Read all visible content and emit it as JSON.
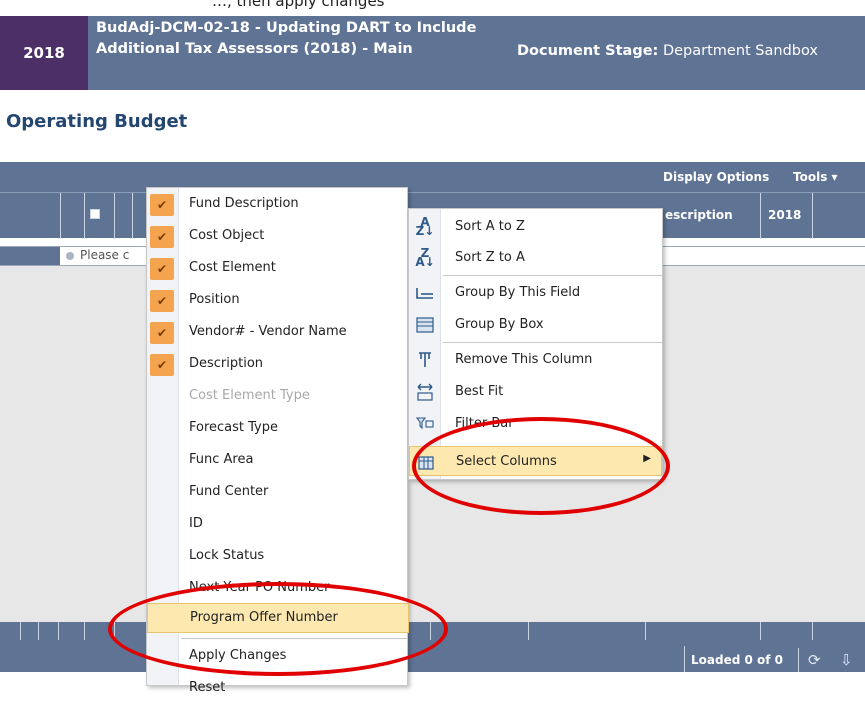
{
  "top_cut_text": "…, then apply changes",
  "header": {
    "year": "2018",
    "title": "BudAdj-DCM-02-18 - Updating DART to Include Additional Tax Assessors (2018) - Main",
    "stage_label": "Document Stage:",
    "stage_value": "Department Sandbox"
  },
  "page": {
    "title": "Operating Budget"
  },
  "grid": {
    "toolbar": {
      "display_options": "Display Options",
      "tools": "Tools",
      "tools_arrow": "▾"
    },
    "header_labels": {
      "description": "escription",
      "year": "2018"
    },
    "filter_placeholder": "Please c",
    "status": {
      "loaded": "Loaded 0 of 0"
    }
  },
  "column_menu": {
    "items": [
      {
        "label": "Fund Description",
        "checked": true
      },
      {
        "label": "Cost Object",
        "checked": true
      },
      {
        "label": "Cost Element",
        "checked": true
      },
      {
        "label": "Position",
        "checked": true
      },
      {
        "label": "Vendor# - Vendor Name",
        "checked": true
      },
      {
        "label": "Description",
        "checked": true
      },
      {
        "label": "Cost Element Type",
        "checked": false,
        "disabled": true
      },
      {
        "label": "Forecast Type",
        "checked": false
      },
      {
        "label": "Func Area",
        "checked": false
      },
      {
        "label": "Fund Center",
        "checked": false
      },
      {
        "label": "ID",
        "checked": false
      },
      {
        "label": "Lock Status",
        "checked": false
      },
      {
        "label": "Next Year PO Number",
        "checked": false
      },
      {
        "label": "Program Offer Number",
        "checked": false,
        "highlighted": true
      }
    ],
    "apply_changes": "Apply Changes",
    "reset": "Reset",
    "check_glyph": "✔"
  },
  "context_menu": {
    "sort_az": "Sort A to Z",
    "sort_za": "Sort Z to A",
    "group_by_field": "Group By This Field",
    "group_by_box": "Group By Box",
    "remove_column": "Remove This Column",
    "best_fit": "Best Fit",
    "filter_bar": "Filter Bar",
    "select_columns": "Select Columns",
    "submenu_arrow": "▶"
  },
  "colors": {
    "header_bg": "#5f7394",
    "year_bg": "#4c2f66",
    "title_color": "#24466f",
    "check_bg": "#f4a34f",
    "highlight_bg": "#fde8b0",
    "annotation_red": "#e00000"
  }
}
